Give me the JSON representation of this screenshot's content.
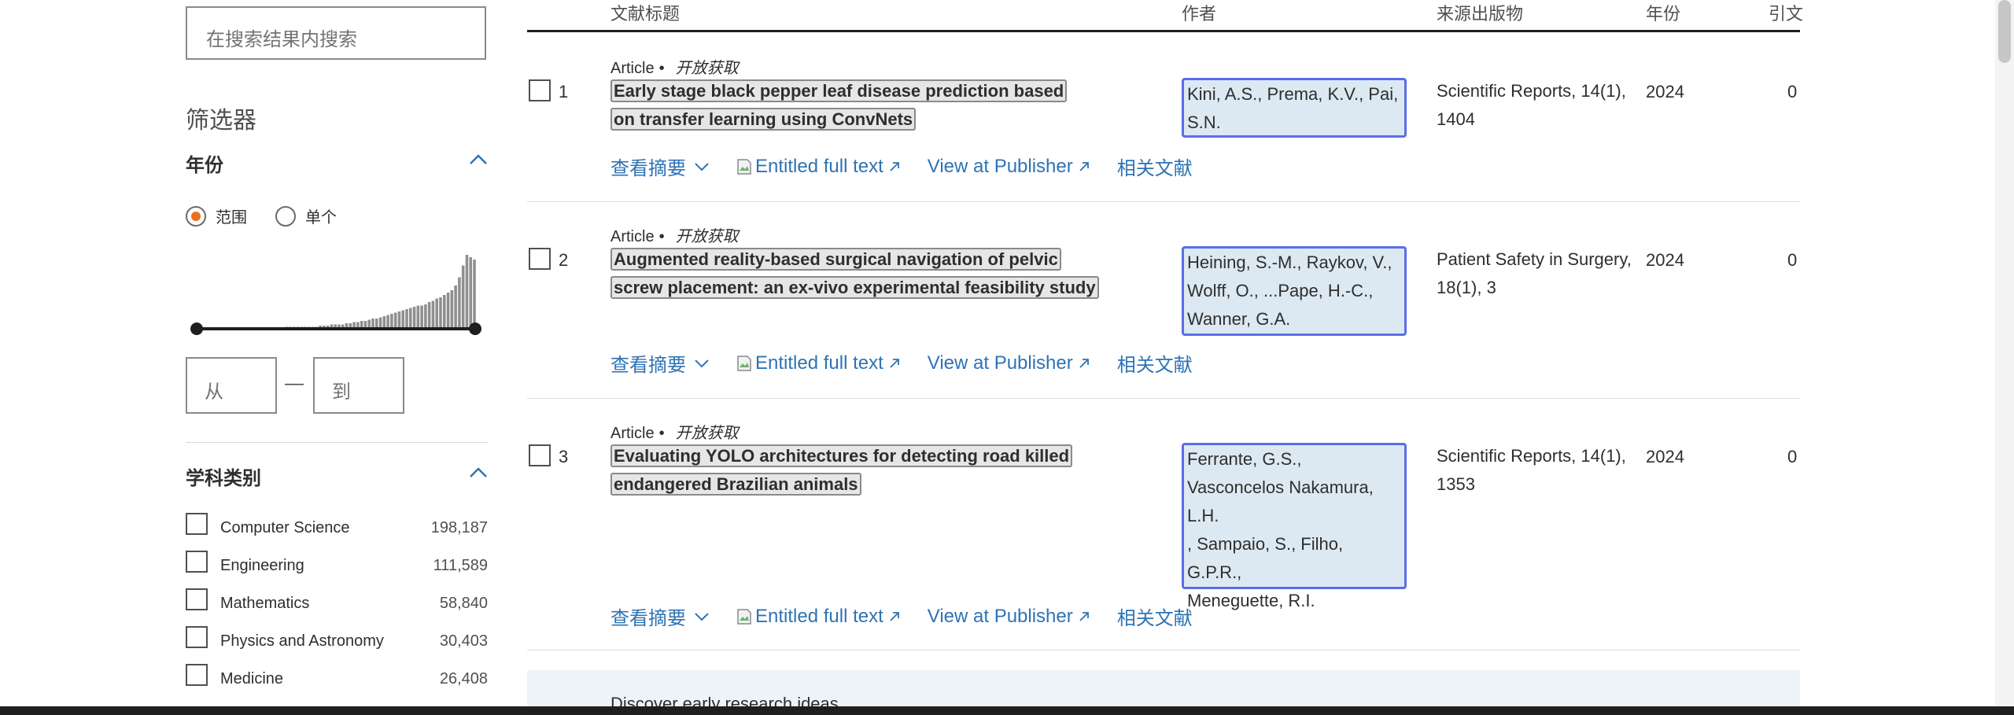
{
  "search": {
    "placeholder": "在搜索结果内搜索"
  },
  "filters": {
    "title": "筛选器",
    "year_facet": {
      "title": "年份",
      "range_label": "范围",
      "single_label": "单个",
      "selected_mode": "范围",
      "from_placeholder": "从",
      "to_placeholder": "到",
      "separator": "—"
    },
    "subject_facet": {
      "title": "学科类别",
      "items": [
        {
          "label": "Computer Science",
          "count": "198,187"
        },
        {
          "label": "Engineering",
          "count": "111,589"
        },
        {
          "label": "Mathematics",
          "count": "58,840"
        },
        {
          "label": "Physics and Astronomy",
          "count": "30,403"
        },
        {
          "label": "Medicine",
          "count": "26,408"
        }
      ]
    }
  },
  "table": {
    "headers": {
      "title": "文献标题",
      "authors": "作者",
      "source": "来源出版物",
      "year": "年份",
      "cited": "引文"
    },
    "rows": [
      {
        "num": "1",
        "doc_type": "Article",
        "bullet": "•",
        "open_access": "开放获取",
        "title": "Early stage black pepper leaf disease prediction based on transfer learning using ConvNets",
        "authors": "Kini, A.S., Prema, K.V., Pai, S.N.",
        "source": "Scientific Reports, 14(1), 1404",
        "year": "2024",
        "cited": "0"
      },
      {
        "num": "2",
        "doc_type": "Article",
        "bullet": "•",
        "open_access": "开放获取",
        "title": "Augmented reality-based surgical navigation of pelvic screw placement: an ex-vivo experimental feasibility study",
        "authors": "Heining, S.-M., Raykov, V., Wolff, O., ...Pape, H.-C., Wanner, G.A.",
        "source": "Patient Safety in Surgery, 18(1), 3",
        "year": "2024",
        "cited": "0"
      },
      {
        "num": "3",
        "doc_type": "Article",
        "bullet": "•",
        "open_access": "开放获取",
        "title": "Evaluating YOLO architectures for detecting road killed endangered Brazilian animals",
        "authors_lines": [
          "Ferrante, G.S.,",
          "Vasconcelos Nakamura,",
          "L.H.",
          ", Sampaio, S., Filho, G.P.R.,",
          "Meneguette, R.I."
        ],
        "source": "Scientific Reports, 14(1), 1353",
        "year": "2024",
        "cited": "0"
      }
    ],
    "actions": {
      "abstract": "查看摘要",
      "full_text": "Entitled full text",
      "publisher": "View at Publisher",
      "related": "相关文献"
    }
  },
  "discover": {
    "text": "Discover early research ideas"
  },
  "colors": {
    "accent": "#e9711c",
    "link": "#2e73b4",
    "author_border": "#5a6ee8",
    "author_bg": "#dde9f2"
  },
  "year_histogram": [
    1,
    1,
    1,
    1,
    1,
    1,
    1,
    1,
    1,
    1,
    2,
    2,
    2,
    2,
    2,
    2,
    2,
    2,
    2,
    2,
    2,
    3,
    3,
    3,
    3,
    3,
    3,
    3,
    3,
    3,
    4,
    4,
    4,
    5,
    5,
    5,
    5,
    6,
    6,
    7,
    7,
    8,
    8,
    9,
    10,
    10,
    11,
    12,
    13,
    14,
    15,
    16,
    17,
    18,
    19,
    20,
    21,
    21,
    22,
    24,
    25,
    27,
    28,
    30,
    32,
    34,
    38,
    45,
    55,
    64,
    62,
    60
  ]
}
